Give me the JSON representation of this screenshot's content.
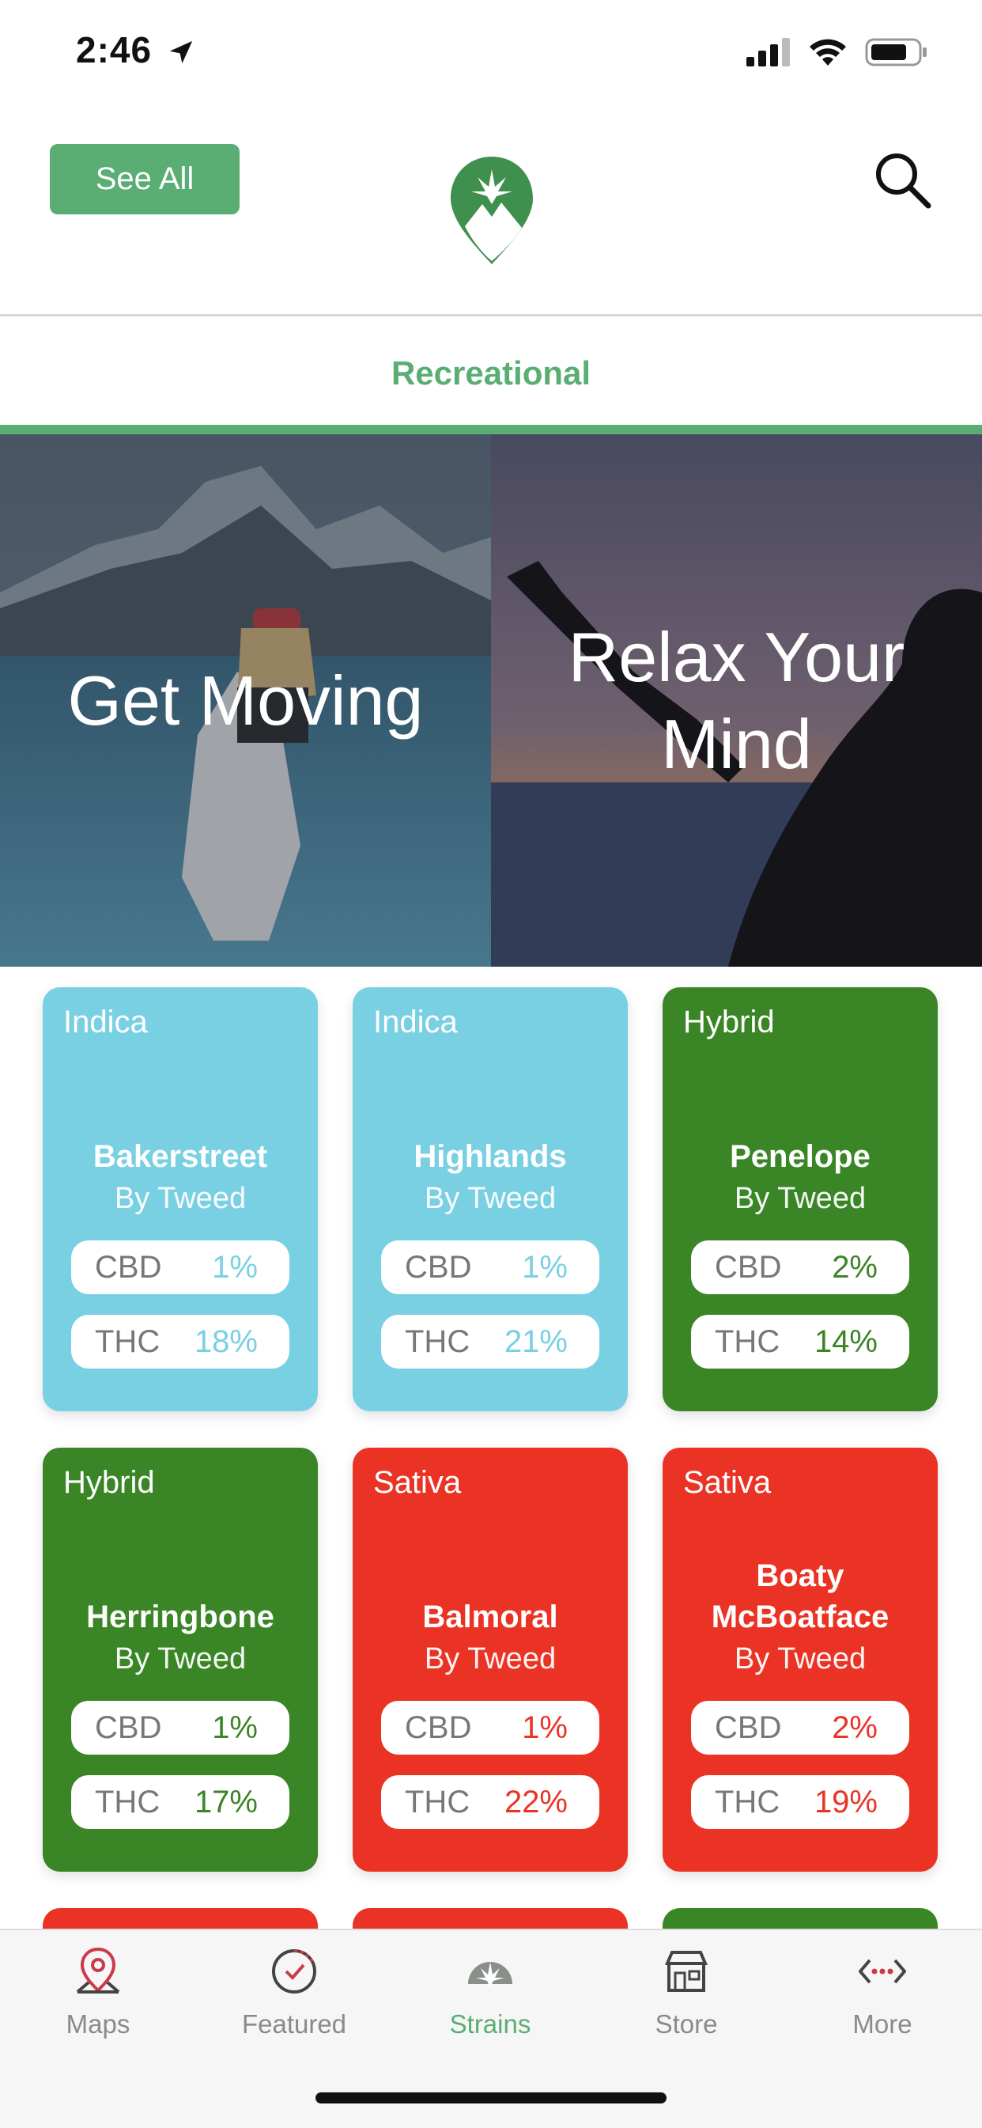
{
  "status_bar": {
    "time": "2:46"
  },
  "header": {
    "see_all_label": "See All"
  },
  "tab": {
    "title": "Recreational"
  },
  "hero": [
    {
      "label": "Get Moving"
    },
    {
      "label_line1": "Relax Your",
      "label_line2": "Mind"
    }
  ],
  "cards": [
    {
      "type": "Indica",
      "name": "Bakerstreet",
      "by": "By Tweed",
      "cbd_label": "CBD",
      "cbd": "1%",
      "thc_label": "THC",
      "thc": "18%"
    },
    {
      "type": "Indica",
      "name": "Highlands",
      "by": "By Tweed",
      "cbd_label": "CBD",
      "cbd": "1%",
      "thc_label": "THC",
      "thc": "21%"
    },
    {
      "type": "Hybrid",
      "name": "Penelope",
      "by": "By Tweed",
      "cbd_label": "CBD",
      "cbd": "2%",
      "thc_label": "THC",
      "thc": "14%"
    },
    {
      "type": "Hybrid",
      "name": "Herringbone",
      "by": "By Tweed",
      "cbd_label": "CBD",
      "cbd": "1%",
      "thc_label": "THC",
      "thc": "17%"
    },
    {
      "type": "Sativa",
      "name": "Balmoral",
      "by": "By Tweed",
      "cbd_label": "CBD",
      "cbd": "1%",
      "thc_label": "THC",
      "thc": "22%"
    },
    {
      "type": "Sativa",
      "name_line1": "Boaty",
      "name_line2": "McBoatface",
      "by": "By Tweed",
      "cbd_label": "CBD",
      "cbd": "2%",
      "thc_label": "THC",
      "thc": "19%"
    }
  ],
  "nav": [
    {
      "label": "Maps",
      "icon": "map-pin-icon"
    },
    {
      "label": "Featured",
      "icon": "featured-check-icon"
    },
    {
      "label": "Strains",
      "icon": "leaf-icon",
      "active": true
    },
    {
      "label": "Store",
      "icon": "store-icon"
    },
    {
      "label": "More",
      "icon": "code-dots-icon"
    }
  ],
  "colors": {
    "brand_green": "#5aad73",
    "indica": "#79d0e3",
    "hybrid": "#3a8526",
    "sativa": "#eb3325"
  }
}
